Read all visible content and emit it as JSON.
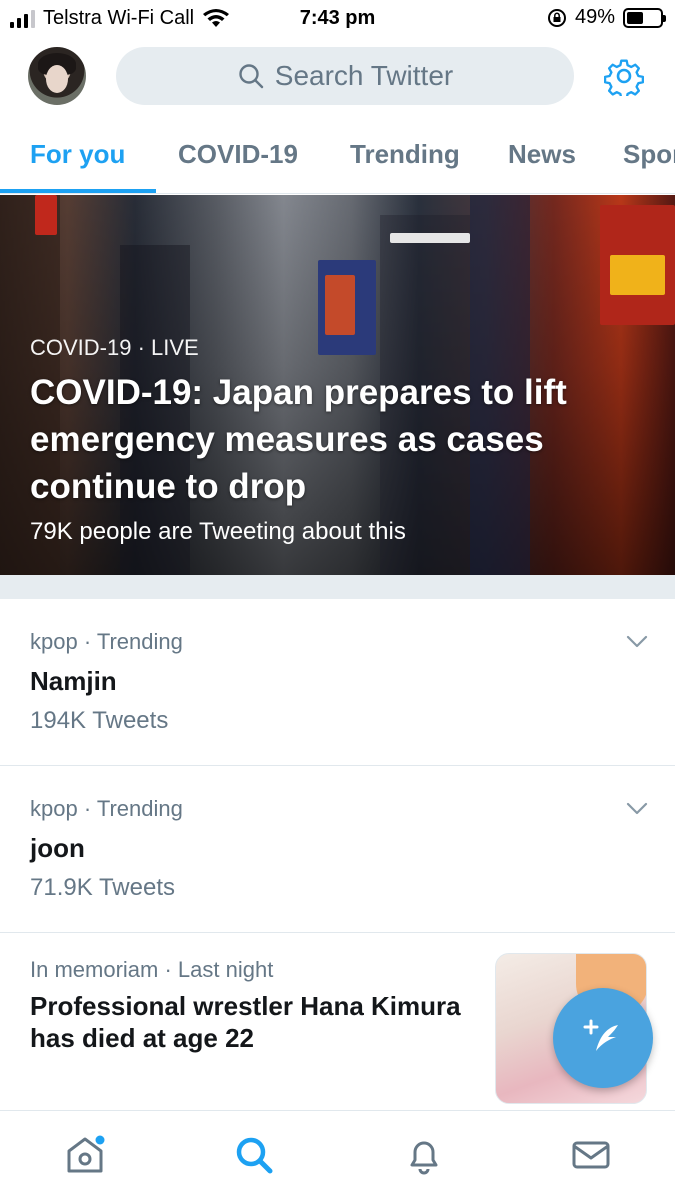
{
  "status_bar": {
    "carrier": "Telstra Wi-Fi Call",
    "time": "7:43 pm",
    "battery_percent": "49%",
    "battery_level": 0.49
  },
  "header": {
    "search_placeholder": "Search Twitter",
    "icons": [
      "search-icon",
      "gear-icon"
    ]
  },
  "tabs": [
    {
      "label": "For you",
      "active": true
    },
    {
      "label": "COVID-19",
      "active": false
    },
    {
      "label": "Trending",
      "active": false
    },
    {
      "label": "News",
      "active": false
    },
    {
      "label": "Spor",
      "active": false
    }
  ],
  "hero": {
    "category": "COVID-19 · LIVE",
    "title": "COVID-19: Japan prepares to lift emergency measures as cases continue to drop",
    "meta": "79K people are Tweeting about this"
  },
  "trends": [
    {
      "context": "kpop · Trending",
      "name": "Namjin",
      "count": "194K Tweets"
    },
    {
      "context": "kpop · Trending",
      "name": "joon",
      "count": "71.9K Tweets"
    }
  ],
  "news": {
    "context": "In memoriam · Last night",
    "title": "Professional wrestler Hana Kimura has died at age 22"
  },
  "colors": {
    "accent": "#1da1f2",
    "muted": "#657786",
    "fab": "#4aa3df"
  },
  "bottom_nav": [
    "home-icon",
    "search-icon",
    "bell-icon",
    "mail-icon"
  ]
}
